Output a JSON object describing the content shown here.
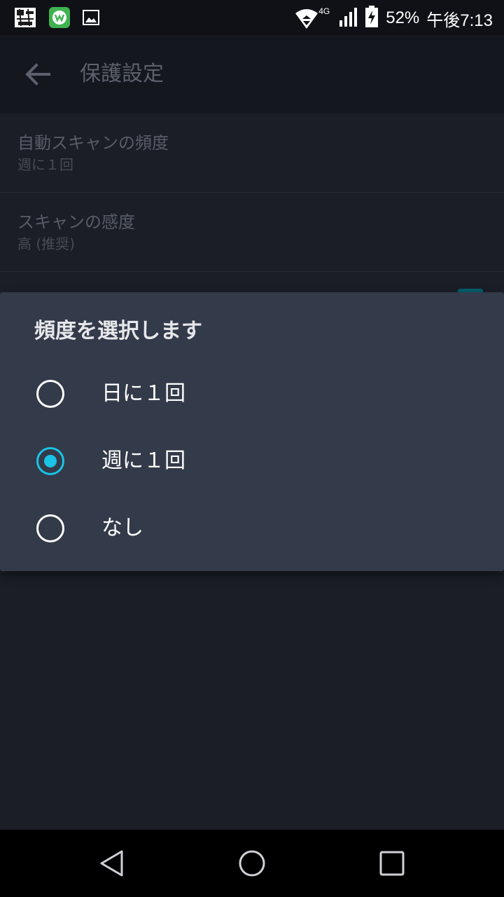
{
  "status_bar": {
    "battery": "52%",
    "time": "午後7:13",
    "network": "4G",
    "icons": [
      "notification-app-icon",
      "wv-app-icon",
      "image-icon",
      "wifi-icon",
      "signal-icon",
      "battery-charging-icon"
    ]
  },
  "app_bar": {
    "title": "保護設定",
    "back_icon": "arrow-back-icon"
  },
  "settings": [
    {
      "title": "自動スキャンの頻度",
      "value": "週に１回"
    },
    {
      "title": "スキャンの感度",
      "value": "高 (推奨)"
    }
  ],
  "dialog": {
    "title": "頻度を選択します",
    "options": [
      {
        "label": "日に１回",
        "selected": false
      },
      {
        "label": "週に１回",
        "selected": true
      },
      {
        "label": "なし",
        "selected": false
      }
    ]
  },
  "nav_bar": {
    "icons": [
      "back-triangle-icon",
      "home-circle-icon",
      "recents-square-icon"
    ]
  },
  "colors": {
    "accent": "#19c3e6",
    "dialog_bg": "#333a49",
    "background": "#1b1e27"
  }
}
